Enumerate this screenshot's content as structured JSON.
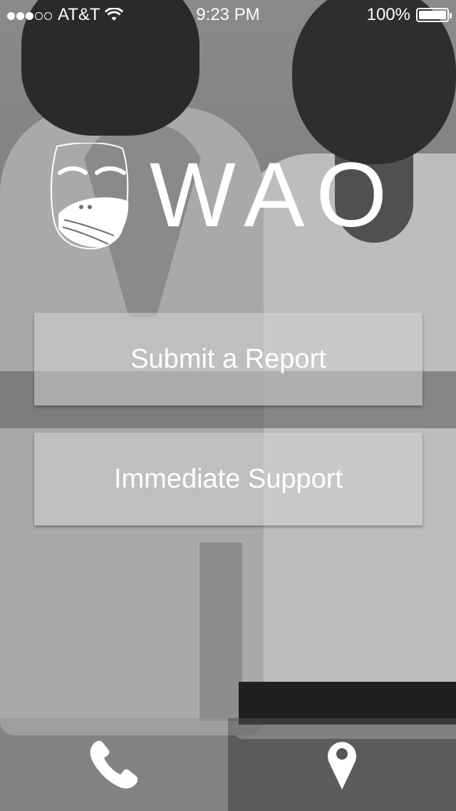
{
  "status_bar": {
    "carrier": "AT&T",
    "time": "9:23 PM",
    "battery": "100%",
    "battery_level": 1.0,
    "signal_bars": 3,
    "signal_max": 5,
    "wifi_icon": "wifi-icon"
  },
  "logo": {
    "text": "WAO",
    "mark_icon": "face-covered-mouth-logo"
  },
  "buttons": {
    "submit_report": "Submit a Report",
    "immediate_support": "Immediate Support"
  },
  "bottom_bar": {
    "call_icon": "phone-icon",
    "location_icon": "map-pin-icon"
  }
}
